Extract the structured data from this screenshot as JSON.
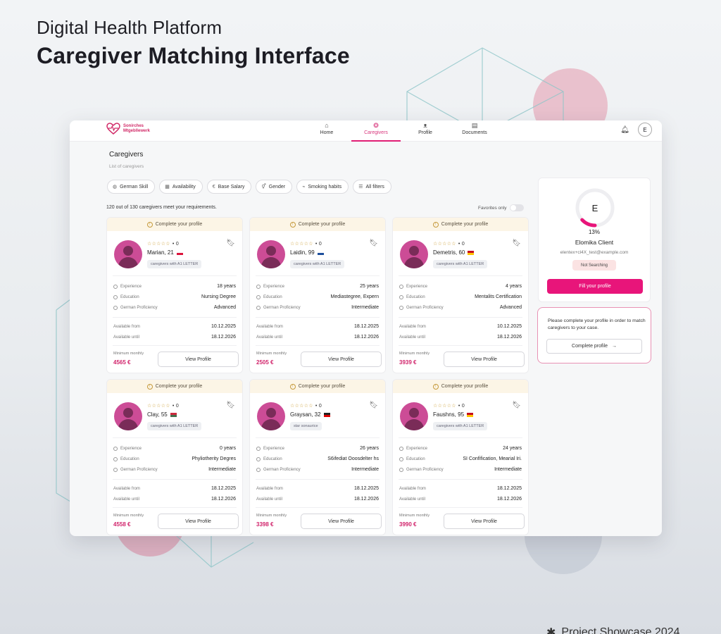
{
  "page": {
    "subtitle": "Digital Health Platform",
    "title": "Caregiver Matching Interface"
  },
  "app": {
    "logo_line1": "Sonirches",
    "logo_line2": "Mtgebllewerk",
    "nav": [
      {
        "label": "Home",
        "icon": "home-icon",
        "active": false
      },
      {
        "label": "Caregivers",
        "icon": "caregivers-icon",
        "active": true
      },
      {
        "label": "Profile",
        "icon": "profile-icon",
        "active": false
      },
      {
        "label": "Documents",
        "icon": "documents-icon",
        "active": false
      }
    ],
    "user_initial": "E"
  },
  "main": {
    "heading": "Caregivers",
    "subheading": "List of caregivers",
    "filters": [
      {
        "label": "German Skill",
        "icon": "globe-icon"
      },
      {
        "label": "Availability",
        "icon": "calendar-icon"
      },
      {
        "label": "Base Salary",
        "icon": "euro-icon"
      },
      {
        "label": "Gender",
        "icon": "gender-icon"
      },
      {
        "label": "Smoking habits",
        "icon": "smoking-icon"
      },
      {
        "label": "All filters",
        "icon": "sliders-icon"
      }
    ],
    "results_text": "120 out of 130 caregivers meet your requirements.",
    "favorites_label": "Favorites only"
  },
  "cards": [
    {
      "banner": "Complete your profile",
      "stars": "☆☆☆☆☆",
      "rating": "• 0",
      "name": "Marian, 21",
      "flag": "pl",
      "tag": "caregivers with A1 LETTER",
      "experience_label": "Experience",
      "experience": "18 years",
      "education_label": "Education",
      "education": "Nursing Degree",
      "german_label": "German Proficiency",
      "german": "Advanced",
      "from_label": "Available from",
      "from": "10.12.2025",
      "until_label": "Available until",
      "until": "18.12.2026",
      "min_label": "Minimum monthly",
      "price": "4565 €",
      "button": "View Profile"
    },
    {
      "banner": "Complete your profile",
      "stars": "☆☆☆☆☆",
      "rating": "• 0",
      "name": "Laidin, 99",
      "flag": "fi",
      "tag": "caregivers with A1 LETTER",
      "experience_label": "Experience",
      "experience": "25 years",
      "education_label": "Education",
      "education": "Mediastegree, Expern",
      "german_label": "German Proficiency",
      "german": "Intermediate",
      "from_label": "Available from",
      "from": "18.12.2025",
      "until_label": "Available until",
      "until": "18.12.2026",
      "min_label": "Minimum monthly",
      "price": "2505 €",
      "button": "View Profile"
    },
    {
      "banner": "Complete your profile",
      "stars": "☆☆☆☆☆",
      "rating": "• 0",
      "name": "Demetris, 60",
      "flag": "es",
      "tag": "caregivers with A1 LETTER",
      "experience_label": "Experience",
      "experience": "4 years",
      "education_label": "Education",
      "education": "Mentalits Certification",
      "german_label": "German Proficiency",
      "german": "Advanced",
      "from_label": "Available from",
      "from": "10.12.2025",
      "until_label": "Available until",
      "until": "18.12.2026",
      "min_label": "Minimum monthly",
      "price": "3939 €",
      "button": "View Profile"
    },
    {
      "banner": "Complete your profile",
      "stars": "☆☆☆☆☆",
      "rating": "• 0",
      "name": "Clay, 55",
      "flag": "hu",
      "tag": "caregivers with A1 LETTER",
      "experience_label": "Experience",
      "experience": "0 years",
      "education_label": "Education",
      "education": "Phyliotherity Degres",
      "german_label": "German Proficiency",
      "german": "Intermediate",
      "from_label": "Available from",
      "from": "18.12.2025",
      "until_label": "Available until",
      "until": "18.12.2026",
      "min_label": "Minimum monthly",
      "price": "4558 €",
      "button": "View Profile"
    },
    {
      "banner": "Complete your profile",
      "stars": "☆☆☆☆☆",
      "rating": "• 0",
      "name": "Graysan, 32",
      "flag": "de",
      "tag": "star sonaurice",
      "experience_label": "Experience",
      "experience": "26 years",
      "education_label": "Education",
      "education": "S6ifediat Ooosdelter hs",
      "german_label": "German Proficiency",
      "german": "Intermediate",
      "from_label": "Available from",
      "from": "18.12.2025",
      "until_label": "Available until",
      "until": "18.12.2026",
      "min_label": "Minimum monthly",
      "price": "3398 €",
      "button": "View Profile"
    },
    {
      "banner": "Complete your profile",
      "stars": "☆☆☆☆☆",
      "rating": "• 0",
      "name": "Faushns, 95",
      "flag": "es",
      "tag": "caregivers with A1 LETTER",
      "experience_label": "Experience",
      "experience": "24 years",
      "education_label": "Education",
      "education": "SI Confification, Mearial Iri.",
      "german_label": "German Proficiency",
      "german": "Intermediate",
      "from_label": "Available from",
      "from": "18.12.2025",
      "until_label": "Available until",
      "until": "18.12.2026",
      "min_label": "Minimum monthly",
      "price": "3990 €",
      "button": "View Profile"
    }
  ],
  "profile": {
    "initial": "E",
    "completion_pct": 13,
    "completion_text": "13%",
    "name": "Elomika Client",
    "email": "elentex+cl4X_test@example.com",
    "status": "Not Searching",
    "fill_button": "Fill your profile"
  },
  "notice": {
    "text": "Please complete your profile in order to match caregivers to your case.",
    "button": "Complete profile",
    "arrow": "→"
  },
  "footer": {
    "text": "Project Showcase 2024"
  },
  "colors": {
    "accent": "#e8157a",
    "avatar": "#cc4c96",
    "price": "#d1236b",
    "banner": "#fcf5e6",
    "star": "#c99826"
  }
}
